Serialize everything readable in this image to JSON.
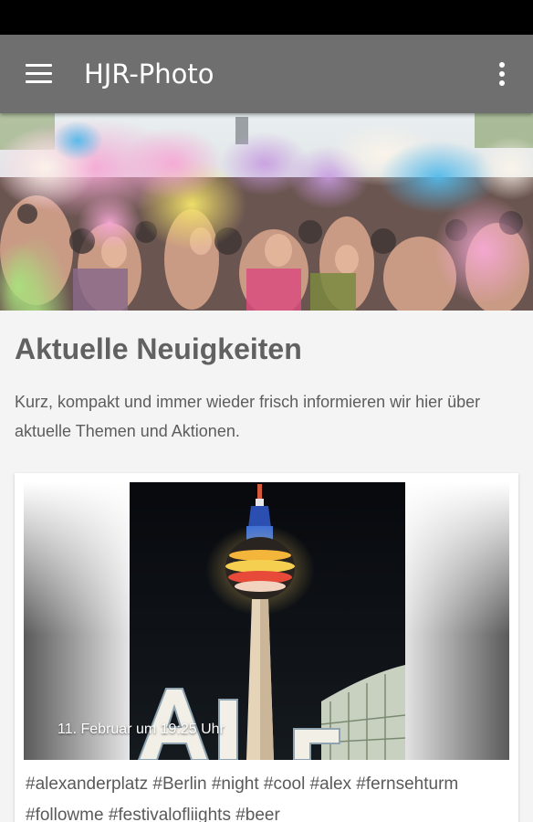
{
  "app": {
    "title": "HJR-Photo",
    "menu_icon": "hamburger-menu-icon",
    "overflow_icon": "more-vert-icon",
    "bar_color": "#6f6f6f"
  },
  "news": {
    "heading": "Aktuelle Neuigkeiten",
    "description": "Kurz, kompakt und immer wieder frisch informieren wir hier über aktuelle Themen und Aktionen."
  },
  "post": {
    "date": "11. Februar um 19:25 Uhr",
    "text": "#alexanderplatz #Berlin #night #cool #alex #fernsehturm #followme #festivalofliights #beer"
  }
}
